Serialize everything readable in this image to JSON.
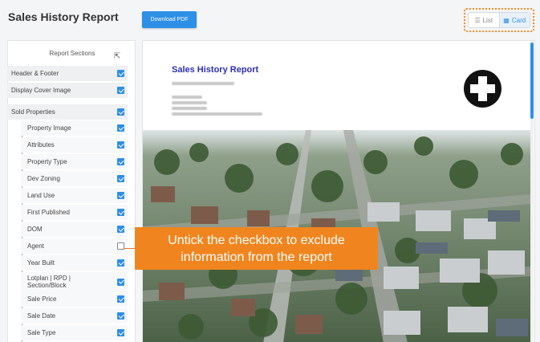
{
  "header": {
    "title": "Sales History Report",
    "download_label": "Download PDF"
  },
  "view_toggle": {
    "list_label": "List",
    "card_label": "Card",
    "active": "Card",
    "list_icon": "list-icon",
    "card_icon": "grid-icon"
  },
  "sections": {
    "title": "Report Sections",
    "items": [
      {
        "label": "Header & Footer",
        "checked": true,
        "level": 0
      },
      {
        "label": "Display Cover Image",
        "checked": true,
        "level": 0
      },
      {
        "label": "Sold Properties",
        "checked": true,
        "level": 0
      },
      {
        "label": "Property Image",
        "checked": true,
        "level": 1
      },
      {
        "label": "Attributes",
        "checked": true,
        "level": 1
      },
      {
        "label": "Property Type",
        "checked": true,
        "level": 1
      },
      {
        "label": "Dev Zoning",
        "checked": true,
        "level": 1
      },
      {
        "label": "Land Use",
        "checked": true,
        "level": 1
      },
      {
        "label": "First Published",
        "checked": true,
        "level": 1
      },
      {
        "label": "DOM",
        "checked": true,
        "level": 1
      },
      {
        "label": "Agent",
        "checked": false,
        "level": 1
      },
      {
        "label": "Year Built",
        "checked": true,
        "level": 1
      },
      {
        "label": "Lotplan | RPD | Section/Block",
        "checked": true,
        "level": 1
      },
      {
        "label": "Sale Price",
        "checked": true,
        "level": 1
      },
      {
        "label": "Sale Date",
        "checked": true,
        "level": 1
      },
      {
        "label": "Sale Type",
        "checked": true,
        "level": 1
      }
    ]
  },
  "callout": {
    "line1": "Untick the checkbox to exclude",
    "line2": "information from the report"
  },
  "preview": {
    "report_title": "Sales History Report",
    "logo": "plus-cross-logo"
  },
  "colors": {
    "accent": "#2d8fe6",
    "callout": "#f0851f",
    "report_title": "#2b2fb5"
  }
}
